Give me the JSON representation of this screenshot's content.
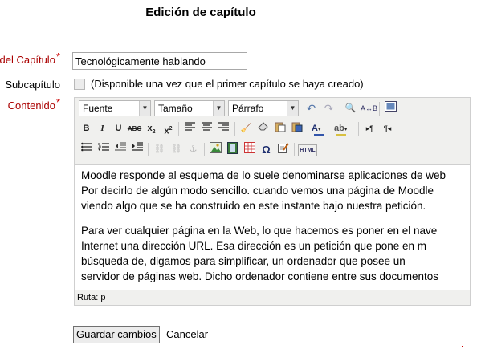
{
  "page": {
    "title": "Edición de capítulo"
  },
  "form": {
    "chapter_label": "del Capítulo",
    "chapter_value": "Tecnológicamente hablando",
    "subchapter_label": "Subcapítulo",
    "subchapter_note": "(Disponible una vez que el primer capítulo se haya creado)",
    "content_label": "Contenido",
    "required_mark": "*"
  },
  "editor": {
    "font_select": "Fuente",
    "size_select": "Tamaño",
    "paragraph_select": "Párrafo",
    "paragraphs": [
      [
        "Moodle responde al esquema de lo suele denominarse aplicaciones de web",
        "Por decirlo de algún modo sencillo. cuando vemos una página de Moodle",
        "viendo algo que se ha construido en este instante bajo nuestra petición."
      ],
      [
        "Para ver cualquier página en la Web, lo que hacemos es poner en el nave",
        "Internet una dirección URL. Esa dirección es un petición que pone en m",
        "búsqueda de, digamos para simplificar, un ordenador que posee un",
        "servidor de páginas web. Dicho ordenador contiene entre sus documentos"
      ]
    ],
    "status_path": "Ruta: p"
  },
  "actions": {
    "save_label": "Guardar cambios",
    "cancel_label": "Cancelar"
  },
  "toolbar_icons": {
    "row1": [
      "undo-icon",
      "redo-icon",
      "find-icon",
      "replace-icon",
      "fullscreen-icon"
    ],
    "row2": [
      "bold-icon",
      "italic-icon",
      "underline-icon",
      "strikethrough-icon",
      "subscript-icon",
      "superscript-icon",
      "align-left-icon",
      "align-center-icon",
      "align-right-icon",
      "clean-icon",
      "eraser-icon",
      "paste-text-icon",
      "paste-word-icon",
      "text-color-icon",
      "highlight-icon",
      "ltr-icon",
      "rtl-icon"
    ],
    "row3": [
      "bullet-list-icon",
      "numbered-list-icon",
      "outdent-icon",
      "indent-icon",
      "link-icon",
      "unlink-icon",
      "anchor-icon",
      "image-icon",
      "media-icon",
      "table-icon",
      "special-char-icon",
      "spellcheck-icon",
      "html-icon"
    ]
  },
  "colors": {
    "required": "#aa0000",
    "toolbar_bg": "#f0f0ee",
    "border": "#cfcfcf"
  }
}
